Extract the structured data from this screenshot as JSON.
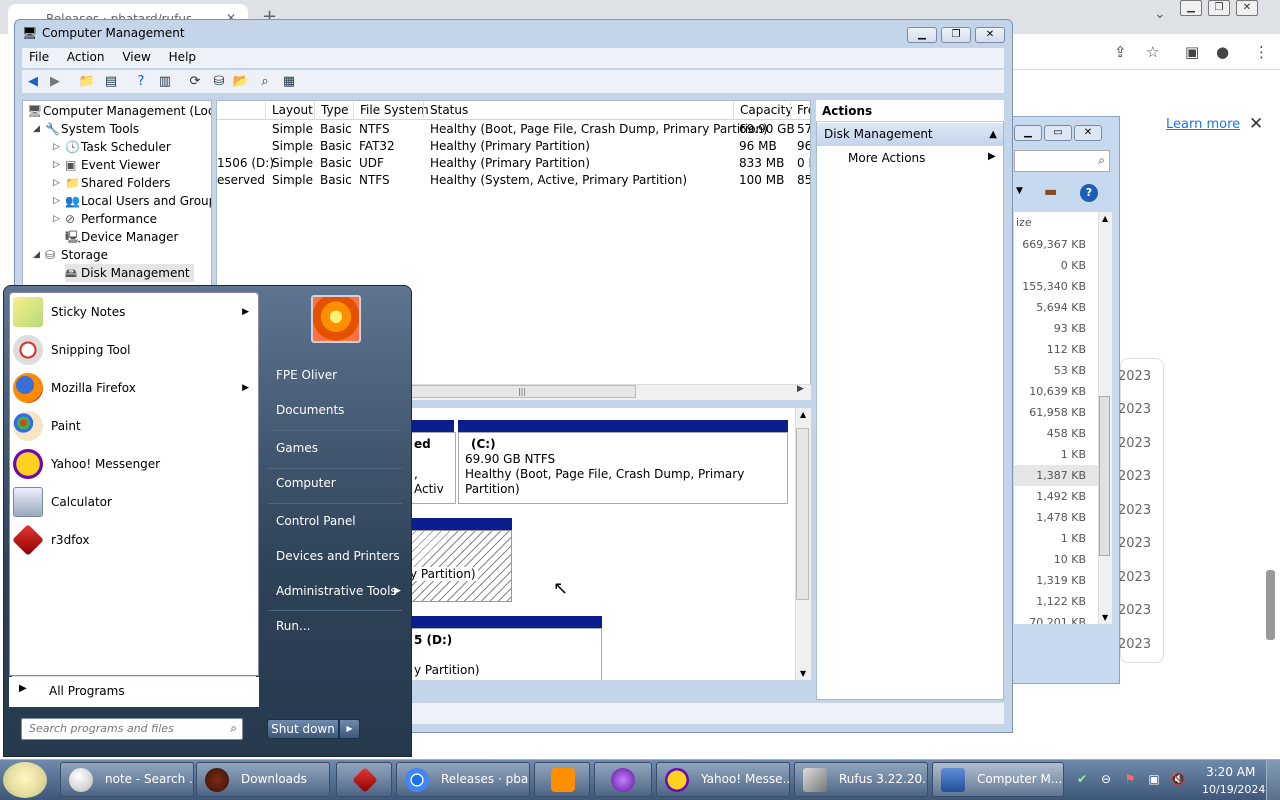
{
  "browser": {
    "tab_title": "Releases · pbatard/rufus",
    "learn_more": "Learn more",
    "years": [
      "2023",
      "2023",
      "2023",
      "2023",
      "2023",
      "2023",
      "2023",
      "2023",
      "2023"
    ]
  },
  "explorer": {
    "size_header": "ize",
    "sizes": [
      "669,367 KB",
      "0 KB",
      "155,340 KB",
      "5,694 KB",
      "93 KB",
      "112 KB",
      "53 KB",
      "10,639 KB",
      "61,958 KB",
      "458 KB",
      "1 KB",
      "1,387 KB",
      "1,492 KB",
      "1,478 KB",
      "1 KB",
      "10 KB",
      "1,319 KB",
      "1,122 KB",
      "70,201 KB"
    ]
  },
  "window": {
    "title": "Computer Management",
    "menu": [
      "File",
      "Action",
      "View",
      "Help"
    ]
  },
  "tree": {
    "root": "Computer Management (Local",
    "system_tools": "System Tools",
    "task_scheduler": "Task Scheduler",
    "event_viewer": "Event Viewer",
    "shared_folders": "Shared Folders",
    "local_users": "Local Users and Groups",
    "performance": "Performance",
    "device_manager": "Device Manager",
    "storage": "Storage",
    "disk_management": "Disk Management"
  },
  "grid": {
    "headers": [
      "Layout",
      "Type",
      "File System",
      "Status",
      "Capacity",
      "Fre"
    ],
    "rows": [
      {
        "volume": "",
        "layout": "Simple",
        "type": "Basic",
        "fs": "NTFS",
        "status": "Healthy (Boot, Page File, Crash Dump, Primary Partition)",
        "capacity": "69.90 GB",
        "free": "57."
      },
      {
        "volume": "",
        "layout": "Simple",
        "type": "Basic",
        "fs": "FAT32",
        "status": "Healthy (Primary Partition)",
        "capacity": "96 MB",
        "free": "96"
      },
      {
        "volume": "1506 (D:)",
        "layout": "Simple",
        "type": "Basic",
        "fs": "UDF",
        "status": "Healthy (Primary Partition)",
        "capacity": "833 MB",
        "free": "0 M"
      },
      {
        "volume": "eserved",
        "layout": "Simple",
        "type": "Basic",
        "fs": "NTFS",
        "status": "Healthy (System, Active, Primary Partition)",
        "capacity": "100 MB",
        "free": "85"
      }
    ]
  },
  "disks": {
    "c_label": "(C:)",
    "c_size": "69.90 GB NTFS",
    "c_status": "Healthy (Boot, Page File, Crash Dump, Primary Partition)",
    "reserved_label": "ed",
    "reserved_status": ", Activ",
    "fat_status": "y Partition)",
    "d_label": "5  (D:)",
    "d_status": "y Partition)"
  },
  "actions": {
    "title": "Actions",
    "section": "Disk Management",
    "more": "More Actions"
  },
  "start_menu": {
    "programs": [
      "Sticky Notes",
      "Snipping Tool",
      "Mozilla Firefox",
      "Paint",
      "Yahoo! Messenger",
      "Calculator",
      "r3dfox"
    ],
    "all_programs": "All Programs",
    "search_placeholder": "Search programs and files",
    "right": [
      "FPE Oliver",
      "Documents",
      "Games",
      "Computer",
      "Control Panel",
      "Devices and Printers",
      "Administrative Tools",
      "Run..."
    ],
    "shutdown": "Shut down"
  },
  "taskbar": {
    "buttons": [
      "note - Search ...",
      "Downloads",
      "Releases · pba...",
      "Yahoo! Messe...",
      "Rufus 3.22.20...",
      "Computer M..."
    ],
    "time": "3:20 AM",
    "date": "10/19/2024"
  },
  "colors": {
    "volume_bar": "#0a1e8e",
    "taskbar": "#3e5778",
    "link": "#1a73e8"
  }
}
